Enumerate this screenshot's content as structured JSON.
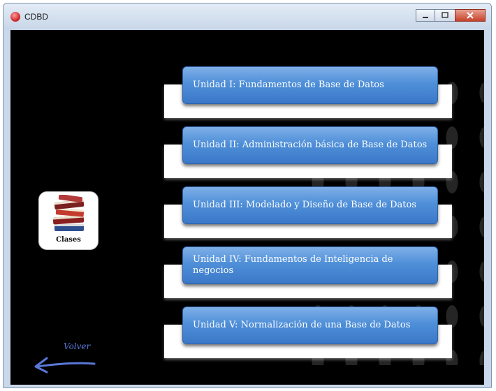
{
  "window": {
    "title": "CDBD"
  },
  "units": [
    {
      "label": "Unidad I: Fundamentos de Base de Datos"
    },
    {
      "label": "Unidad II: Administración básica de  Base de Datos"
    },
    {
      "label": "Unidad III: Modelado y Diseño de Base de Datos"
    },
    {
      "label": "Unidad IV: Fundamentos de Inteligencia de negocios"
    },
    {
      "label": "Unidad V: Normalización de una Base de Datos"
    }
  ],
  "clases": {
    "label": "Clases",
    "icon": "books-icon"
  },
  "back": {
    "label": "Volver",
    "icon": "arrow-left-icon"
  },
  "colors": {
    "background": "#000000",
    "button_blue": "#4f8fd8",
    "panel": "#ffffff",
    "back_arrow": "#5a78d8"
  }
}
